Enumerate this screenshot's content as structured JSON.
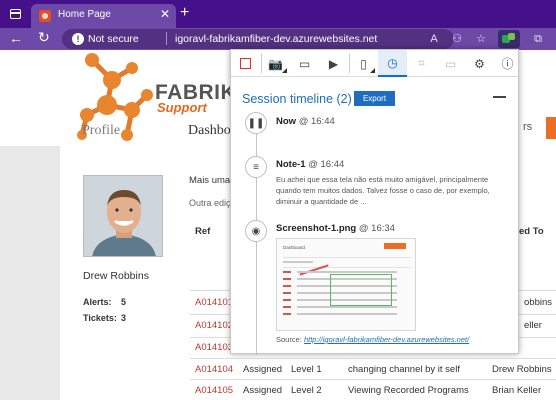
{
  "browser": {
    "tab_title": "Home Page",
    "close_glyph": "✕",
    "newtab_glyph": "+",
    "security_label": "Not secure",
    "url": "igoravl-fabrikamfiber-dev.azurewebsites.net",
    "back_glyph": "←",
    "refresh_glyph": "↻",
    "toolbar_icons": [
      "read-aloud-icon",
      "profile-icon",
      "favorite-icon",
      "extension-icon",
      "more-icon"
    ]
  },
  "site": {
    "logo_text": "FABRIKAM",
    "logo_sub": "Support",
    "nav_partial_1": "rs",
    "nav_partial_2": "En",
    "profile_heading": "Profile",
    "dashboard_heading": "Dashbo",
    "mais_text": "Mais uma",
    "outra_text": "Outra ediç",
    "user_name": "Drew Robbins",
    "alerts_label": "Alerts:",
    "alerts_value": "5",
    "tickets_label": "Tickets:",
    "tickets_value": "3",
    "table_ref_header": "Ref",
    "table_assigned_header": "ed To",
    "rows": [
      {
        "ref": "A014101",
        "status": "",
        "level": "",
        "title": "",
        "assigned": "obbins"
      },
      {
        "ref": "A014102",
        "status": "",
        "level": "",
        "title": "",
        "assigned": "eller"
      },
      {
        "ref": "A014103",
        "status": "",
        "level": "",
        "title": "",
        "assigned": ""
      },
      {
        "ref": "A014104",
        "status": "Assigned",
        "level": "Level 1",
        "title": "changing channel by it self",
        "assigned": "Drew Robbins"
      },
      {
        "ref": "A014105",
        "status": "Assigned",
        "level": "Level 2",
        "title": "Viewing Recorded Programs",
        "assigned": "Brian Keller"
      }
    ]
  },
  "panel": {
    "session_title": "Session timeline (2)",
    "export_label": "Export",
    "items": [
      {
        "title": "Now",
        "time": "@ 16:44"
      },
      {
        "title": "Note-1",
        "time": "@ 16:44",
        "text": "Eu achei que essa tela não está muito amigável, principalmente quando tem muitos dados. Talvez fosse o caso de, por exemplo, diminuir a quantidade de ..."
      },
      {
        "title": "Screenshot-1.png",
        "time": "@ 16:34",
        "source_label": "Source:",
        "source_url": "http://igoravl-fabrikamfiber-dev.azurewebsites.net/"
      }
    ]
  },
  "colors": {
    "chrome_dark": "#44118a",
    "chrome_mid": "#6d4aa8",
    "accent_blue": "#1f6dbf",
    "brand_orange": "#e96f25",
    "ref_red": "#c0392b"
  }
}
